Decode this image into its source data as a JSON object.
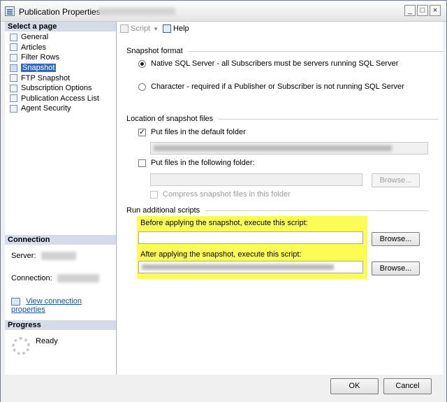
{
  "window": {
    "title": "Publication Properties -",
    "controls": [
      "_",
      "□",
      "×"
    ]
  },
  "left_pane": {
    "select_page_header": "Select a page",
    "pages": [
      {
        "label": "General",
        "icon": "properties-page-icon"
      },
      {
        "label": "Articles",
        "icon": "properties-page-icon"
      },
      {
        "label": "Filter Rows",
        "icon": "filter-page-icon"
      },
      {
        "label": "Snapshot",
        "icon": "properties-page-icon",
        "selected": true
      },
      {
        "label": "FTP Snapshot",
        "icon": "properties-page-icon"
      },
      {
        "label": "Subscription Options",
        "icon": "properties-page-icon"
      },
      {
        "label": "Publication Access List",
        "icon": "properties-page-icon"
      },
      {
        "label": "Agent Security",
        "icon": "properties-page-icon"
      }
    ],
    "connection": {
      "header": "Connection",
      "server_label": "Server:",
      "connection_label": "Connection:",
      "view_link": "View connection properties"
    },
    "progress": {
      "header": "Progress",
      "status": "Ready"
    }
  },
  "toolbar": {
    "script_label": "Script",
    "help_label": "Help"
  },
  "snapshot_format": {
    "title": "Snapshot format",
    "native_label": "Native SQL Server - all Subscribers must be servers running SQL Server",
    "native_selected": true,
    "character_label": "Character - required if a Publisher or Subscriber is not running SQL Server",
    "character_selected": false
  },
  "location": {
    "title": "Location of snapshot files",
    "default_folder_label": "Put files in the default folder",
    "default_folder_checked": true,
    "following_folder_label": "Put files in the following folder:",
    "following_folder_checked": false,
    "browse_label": "Browse...",
    "compress_label": "Compress snapshot files in this folder",
    "compress_checked": false
  },
  "scripts": {
    "title": "Run additional scripts",
    "before_label": "Before applying the snapshot, execute this script:",
    "after_label": "After applying the snapshot, execute this script:",
    "browse_before_label": "Browse...",
    "browse_after_label": "Browse..."
  },
  "buttons": {
    "ok": "OK",
    "cancel": "Cancel"
  },
  "colors": {
    "highlight": "#fdfc55",
    "selection": "#3169c6",
    "pane_header": "#d6dbe9",
    "link": "#1a4fa8"
  }
}
